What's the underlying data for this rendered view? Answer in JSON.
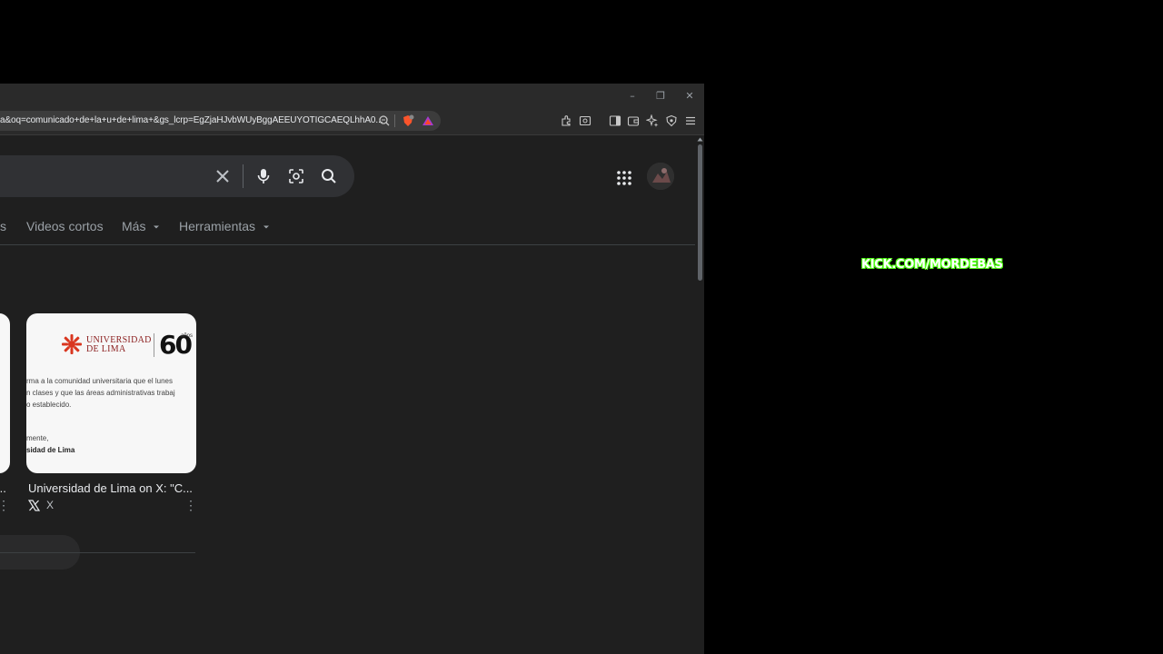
{
  "window": {
    "minimize": "–",
    "restore": "❐",
    "close": "✕"
  },
  "address_bar": {
    "url": "a&oq=comunicado+de+la+u+de+lima+&gs_lcrp=EgZjaHJvbWUyBggAEEUYOTIGCAEQLhhA0..."
  },
  "search": {
    "query": ""
  },
  "tabs": [
    {
      "label": "s"
    },
    {
      "label": "Videos cortos"
    },
    {
      "label": "Más"
    },
    {
      "label": "Herramientas"
    }
  ],
  "results": {
    "card": {
      "title": "Universidad de Lima on X: \"C...",
      "source": "X",
      "image": {
        "university_line1": "UNIVERSIDAD",
        "university_line2": "DE LIMA",
        "anniversary": "60",
        "anniversary_sub": "años",
        "line1": "rma a la comunidad universitaria que el lunes",
        "line2": "n clases y que las áreas administrativas trabaj",
        "line3": "o establecido.",
        "line4": "mente,",
        "line5": "sidad de Lima"
      }
    },
    "prev_card": {
      "title": "...",
      "more": "⋮"
    },
    "more": "⋮"
  },
  "overlay": {
    "kick": "KICK.COM/MORDEBAS"
  },
  "colors": {
    "accent_green": "#53fc18",
    "brand_red": "#8a1c1c"
  }
}
